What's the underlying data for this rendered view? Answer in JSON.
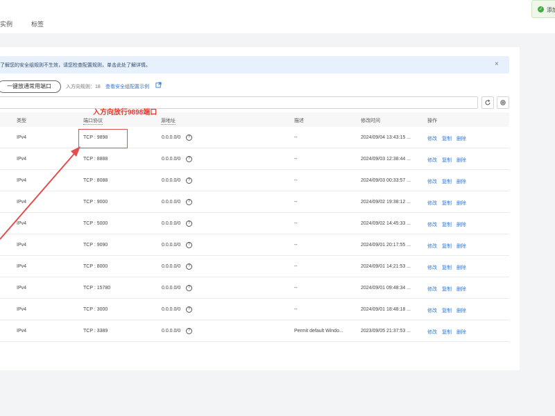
{
  "tabs": [
    {
      "label": "实例"
    },
    {
      "label": "标签"
    }
  ],
  "toast": {
    "text": "添加"
  },
  "notice": {
    "text": "了解您的安全组规则不生效，请您检查配置规则，单击此处了解详情。",
    "close": "×"
  },
  "actions": {
    "add_button": "一键放通常用端口",
    "rule_count_label": "入方向规则：18",
    "tip_link": "查看安全组配置示例"
  },
  "columns": {
    "type": "类型",
    "port": "端口协议",
    "source": "源地址",
    "description": "描述",
    "modified": "修改时间",
    "actions": "操作"
  },
  "row_actions": {
    "edit": "修改",
    "copy": "复制",
    "delete": "删除"
  },
  "rows": [
    {
      "type": "IPv4",
      "port": "TCP : 9898",
      "source": "0.0.0.0/0",
      "description": "--",
      "modified": "2024/09/04 13:43:15 ..."
    },
    {
      "type": "IPv4",
      "port": "TCP : 8888",
      "source": "0.0.0.0/0",
      "description": "--",
      "modified": "2024/09/03 12:38:44 ..."
    },
    {
      "type": "IPv4",
      "port": "TCP : 8088",
      "source": "0.0.0.0/0",
      "description": "--",
      "modified": "2024/09/03 00:33:57 ..."
    },
    {
      "type": "IPv4",
      "port": "TCP : 9000",
      "source": "0.0.0.0/0",
      "description": "--",
      "modified": "2024/09/02 19:38:12 ..."
    },
    {
      "type": "IPv4",
      "port": "TCP : 5000",
      "source": "0.0.0.0/0",
      "description": "--",
      "modified": "2024/09/02 14:45:33 ..."
    },
    {
      "type": "IPv4",
      "port": "TCP : 9090",
      "source": "0.0.0.0/0",
      "description": "--",
      "modified": "2024/09/01 20:17:55 ..."
    },
    {
      "type": "IPv4",
      "port": "TCP : 8000",
      "source": "0.0.0.0/0",
      "description": "--",
      "modified": "2024/09/01 14:21:53 ..."
    },
    {
      "type": "IPv4",
      "port": "TCP : 15780",
      "source": "0.0.0.0/0",
      "description": "--",
      "modified": "2024/09/01 09:48:34 ..."
    },
    {
      "type": "IPv4",
      "port": "TCP : 3000",
      "source": "0.0.0.0/0",
      "description": "--",
      "modified": "2024/09/01 18:48:18 ..."
    },
    {
      "type": "IPv4",
      "port": "TCP : 3389",
      "source": "0.0.0.0/0",
      "description": "Permit default Windo...",
      "modified": "2023/09/05 21:37:53 ..."
    }
  ],
  "annotation": {
    "text": "入方向放行9898端口"
  },
  "colors": {
    "accent": "#2f7ad6",
    "annotation": "#e24d4d",
    "notice_bg": "#e7f1fd"
  }
}
